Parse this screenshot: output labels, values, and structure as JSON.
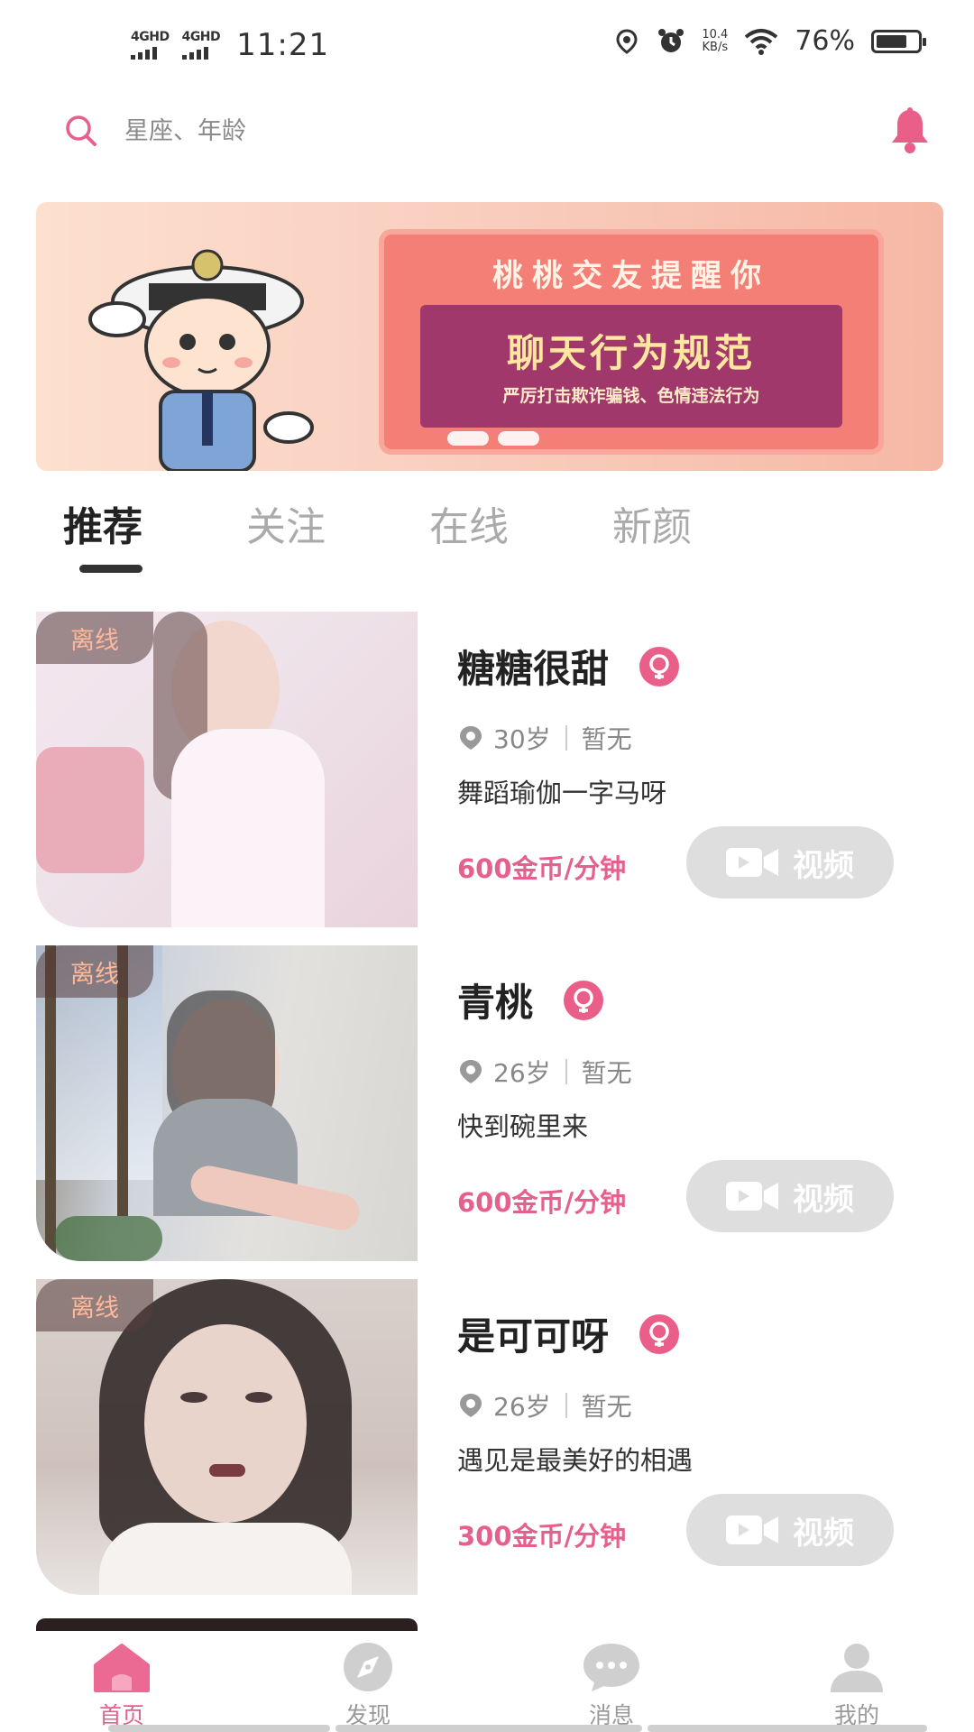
{
  "status_bar": {
    "signal_1": "4GHD",
    "signal_2": "4GHD",
    "time": "11:21",
    "net_rate_value": "10.4",
    "net_rate_unit": "KB/s",
    "battery_pct": "76%",
    "battery_level": 0.76
  },
  "search": {
    "placeholder": "星座、年龄"
  },
  "banner": {
    "title": "桃桃交友提醒你",
    "subtitle": "聊天行为规范",
    "note": "严厉打击欺诈骗钱、色情违法行为"
  },
  "tabs": [
    {
      "label": "推荐",
      "active": true
    },
    {
      "label": "关注",
      "active": false
    },
    {
      "label": "在线",
      "active": false
    },
    {
      "label": "新颜",
      "active": false
    }
  ],
  "profiles": [
    {
      "status": "离线",
      "name": "糖糖很甜",
      "age": "30岁",
      "location": "暂无",
      "signature": "舞蹈瑜伽一字马呀",
      "price": "600金币/分钟",
      "video_label": "视频"
    },
    {
      "status": "离线",
      "name": "青桃",
      "age": "26岁",
      "location": "暂无",
      "signature": "快到碗里来",
      "price": "600金币/分钟",
      "video_label": "视频"
    },
    {
      "status": "离线",
      "name": "是可可呀",
      "age": "26岁",
      "location": "暂无",
      "signature": "遇见是最美好的相遇",
      "price": "300金币/分钟",
      "video_label": "视频"
    }
  ],
  "bottom_nav": [
    {
      "label": "首页",
      "icon": "home-icon",
      "active": true
    },
    {
      "label": "发现",
      "icon": "compass-icon",
      "active": false
    },
    {
      "label": "消息",
      "icon": "chat-bubble-icon",
      "active": false
    },
    {
      "label": "我的",
      "icon": "person-icon",
      "active": false
    }
  ],
  "colors": {
    "accent": "#e5608d",
    "badge": "#ea5f8a",
    "disabled_button": "#dedede"
  }
}
